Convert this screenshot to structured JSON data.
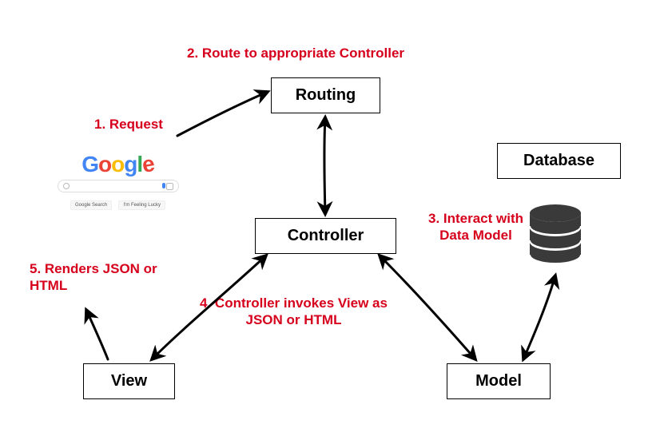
{
  "boxes": {
    "routing": {
      "label": "Routing"
    },
    "controller": {
      "label": "Controller"
    },
    "view": {
      "label": "View"
    },
    "model": {
      "label": "Model"
    },
    "database": {
      "label": "Database"
    }
  },
  "steps": {
    "s1": "1. Request",
    "s2": "2. Route to appropriate Controller",
    "s3": "3. Interact with Data Model",
    "s4": "4. Controller invokes View as JSON or HTML",
    "s5": "5. Renders JSON or HTML"
  },
  "google": {
    "letters": [
      "G",
      "o",
      "o",
      "g",
      "l",
      "e"
    ],
    "btn1": "Google Search",
    "btn2": "I'm Feeling Lucky"
  },
  "colors": {
    "step": "#d6001c",
    "box_border": "#000"
  }
}
